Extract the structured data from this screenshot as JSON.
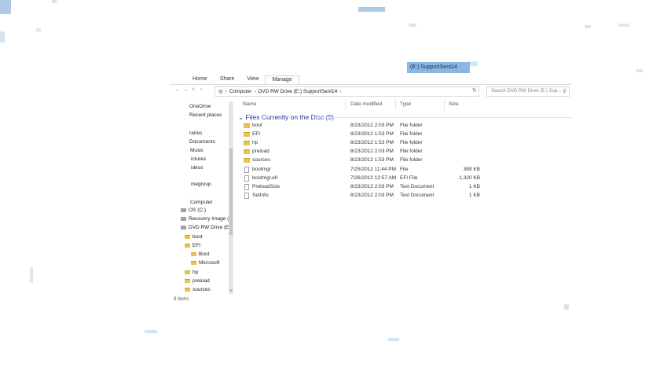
{
  "window": {
    "ribbon_tabs": [
      "Home",
      "Share",
      "View",
      "Manage"
    ],
    "context_tab": "(E:) SupportSent14"
  },
  "address": {
    "back_icon": "back-arrow-icon",
    "forward_icon": "forward-arrow-icon",
    "crumbs": [
      "Computer",
      "DVD RW Drive (E:) SupportSent14"
    ],
    "search_placeholder": "Search DVD RW Drive (E:) Sup..."
  },
  "nav_pane": {
    "items": [
      {
        "label": "Downloads",
        "icon": "none"
      },
      {
        "label": "OneDrive",
        "icon": "none"
      },
      {
        "label": "Recent places",
        "icon": "none"
      },
      {
        "label": "raries",
        "icon": "none"
      },
      {
        "label": "Documents",
        "icon": "none"
      },
      {
        "label": "Music",
        "icon": "none"
      },
      {
        "label": "ictures",
        "icon": "none"
      },
      {
        "label": "ideos",
        "icon": "none"
      },
      {
        "label": "megroup",
        "icon": "none"
      },
      {
        "label": "Computer",
        "icon": "none"
      },
      {
        "label": "OS (C:)",
        "icon": "drive-icon"
      },
      {
        "label": "Recovery Image (",
        "icon": "drive-icon"
      },
      {
        "label": "DVD RW Drive (E:",
        "icon": "drive-icon"
      },
      {
        "label": "boot",
        "icon": "folder-icon"
      },
      {
        "label": "EFI",
        "icon": "folder-icon"
      },
      {
        "label": "Boot",
        "icon": "folder-icon"
      },
      {
        "label": "Microsoft",
        "icon": "folder-icon"
      },
      {
        "label": "hp",
        "icon": "folder-icon"
      },
      {
        "label": "preload",
        "icon": "folder-icon"
      },
      {
        "label": "sources",
        "icon": "folder-icon"
      }
    ]
  },
  "content": {
    "columns": [
      "Name",
      "Date modified",
      "Type",
      "Size"
    ],
    "group_title": "Files Currently on the Disc (9)",
    "rows": [
      {
        "name": "boot",
        "date": "8/23/2012 2:03 PM",
        "type": "File folder",
        "size": "",
        "icon": "folder-icon"
      },
      {
        "name": "EFI",
        "date": "8/23/2012 1:53 PM",
        "type": "File folder",
        "size": "",
        "icon": "folder-icon"
      },
      {
        "name": "hp",
        "date": "8/23/2012 1:53 PM",
        "type": "File folder",
        "size": "",
        "icon": "folder-icon"
      },
      {
        "name": "preload",
        "date": "8/23/2012 2:03 PM",
        "type": "File folder",
        "size": "",
        "icon": "folder-icon"
      },
      {
        "name": "sources",
        "date": "8/23/2012 1:53 PM",
        "type": "File folder",
        "size": "",
        "icon": "folder-icon"
      },
      {
        "name": "bootmgr",
        "date": "7/25/2012 11:44 PM",
        "type": "File",
        "size": "389 KB",
        "icon": "file-icon"
      },
      {
        "name": "bootmgr.efi",
        "date": "7/26/2012 12:57 AM",
        "type": "EFI File",
        "size": "1,320 KB",
        "icon": "file-icon"
      },
      {
        "name": "PreloadSize",
        "date": "8/23/2012 2:03 PM",
        "type": "Text Document",
        "size": "1 KB",
        "icon": "file-icon"
      },
      {
        "name": "SetInfo",
        "date": "8/23/2012 2:03 PM",
        "type": "Text Document",
        "size": "1 KB",
        "icon": "file-icon"
      }
    ]
  },
  "status": {
    "items_count": "9 items"
  }
}
